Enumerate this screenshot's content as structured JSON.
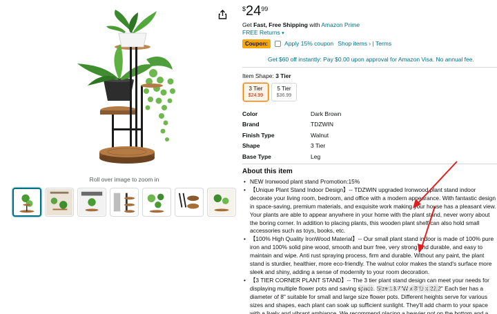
{
  "product": {
    "price_symbol": "$",
    "price_whole": "24",
    "price_fraction": "99"
  },
  "shipping": {
    "get_text": "Get",
    "fast_free": "Fast, Free Shipping",
    "with_text": "with",
    "prime_link": "Amazon Prime",
    "returns_link": "FREE Returns"
  },
  "coupon": {
    "badge": "Coupon:",
    "apply_text": "Apply 15% coupon",
    "shop_items": "Shop items",
    "terms": "Terms"
  },
  "offer": {
    "text": "Get $60 off instantly: Pay $0.00 upon approval for Amazon Visa. No annual fee."
  },
  "shape": {
    "label": "Item Shape:",
    "selected_value": "3 Tier",
    "options": [
      {
        "name": "3 Tier",
        "price": "$24.99"
      },
      {
        "name": "5 Tier",
        "price": "$36.99"
      }
    ]
  },
  "specs": [
    {
      "key": "Color",
      "value": "Dark Brown"
    },
    {
      "key": "Brand",
      "value": "TDZWIN"
    },
    {
      "key": "Finish Type",
      "value": "Walnut"
    },
    {
      "key": "Shape",
      "value": "3 Tier"
    },
    {
      "key": "Base Type",
      "value": "Leg"
    }
  ],
  "about": {
    "title": "About this item",
    "bullets": [
      "NEW Ironwood plant stand Promotion:15%",
      "【Unique Plant Stand Indoor Design】-- TDZWIN upgraded Ironwood plant stand indoor decorate your living room, bedroom, and office with a modern appearance. With fantastic design in space-saving, premium materials, and exquisite work making your house has a pleasant view. Your plants are able to appear anywhere in your home with the plant stand, never worry about the boring corner. In addition to placing plants, this wooden plant shelf can also hold small accessories such as toys, books, etc.",
      "【100% High Quality IronWood Material】-- Our small plant stand indoor is made of 100% pure iron and 100% solid pine wood, smooth and burr free, very strong and durable, and easy to maintain and wipe. Anti rust spraying process, firm and durable. Without any paint, the plant stand is sturdier, healthier, more eco-friendly. The walnut color makes the stand's surface more sleek and shiny, adding a sense of modernity to your room decoration.",
      "【3 TIER CORNER PLANT STAND】-- The 3 tier plant stand design can meet your needs for displaying multiple flower pots and saving space. Size:13.7\"W x 8\"D x 22.2\" Each tier has a diameter of 8\" suitable for small and large size flower pots. Different heights serve for various sizes and shapes, each plant can soak up sufficient sunlight. They'll add charm to your space with a lively and vibrant ambiance. We recommend placing a heavier pot on the bottom and a"
    ]
  },
  "gallery": {
    "rollover_text": "Roll over image to zoom in",
    "thumbnail_count": 7
  },
  "watermark": "知乎 @OKKI出海情报局",
  "colors": {
    "link": "#007185",
    "coupon_badge": "#f7a80f",
    "selected_border": "#e77600",
    "price_red": "#b12704",
    "arrow_red": "#e02020"
  }
}
